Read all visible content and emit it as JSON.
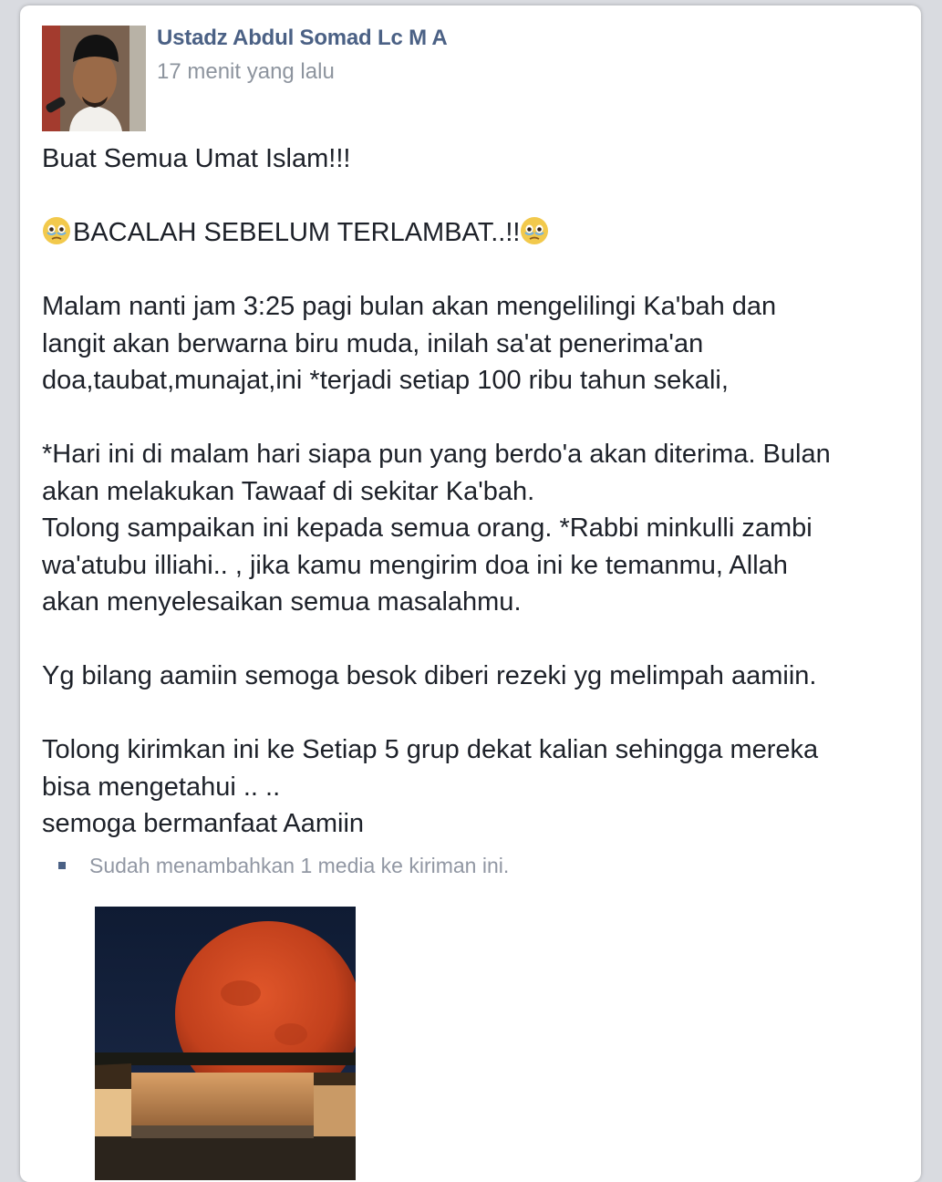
{
  "post": {
    "author": "Ustadz Abdul Somad Lc M A",
    "timestamp": "17 menit yang lalu",
    "paragraphs": [
      [
        "Buat Semua Umat Islam!!!"
      ],
      [
        "BACALAH SEBELUM TERLAMBAT..!!"
      ],
      [
        "Malam nanti jam 3:25 pagi bulan akan mengelilingi Ka'bah dan",
        "langit akan berwarna biru muda, inilah sa'at penerima'an",
        "doa,taubat,munajat,ini *terjadi setiap 100 ribu tahun sekali,"
      ],
      [
        "*Hari ini di malam hari siapa pun yang berdo'a akan diterima. Bulan",
        "akan melakukan Tawaaf di sekitar Ka'bah.",
        "Tolong sampaikan ini kepada semua orang. *Rabbi minkulli zambi",
        "wa'atubu illiahi.. , jika kamu mengirim doa ini ke temanmu, Allah",
        "akan menyelesaikan semua masalahmu."
      ],
      [
        "Yg bilang aamiin semoga besok diberi rezeki yg melimpah aamiin."
      ],
      [
        "Tolong kirimkan ini ke Setiap 5 grup dekat kalian sehingga mereka",
        "bisa mengetahui .. ..",
        "semoga bermanfaat Aamiin"
      ]
    ],
    "media_note": "Sudah menambahkan 1 media ke kiriman ini."
  },
  "icons": {
    "emoji": "crying-face-emoji",
    "bullet": "square-bullet-icon"
  },
  "colors": {
    "author": "#4b6185",
    "timestamp": "#8d949e",
    "text": "#1d2129",
    "media_note": "#9197a3"
  }
}
